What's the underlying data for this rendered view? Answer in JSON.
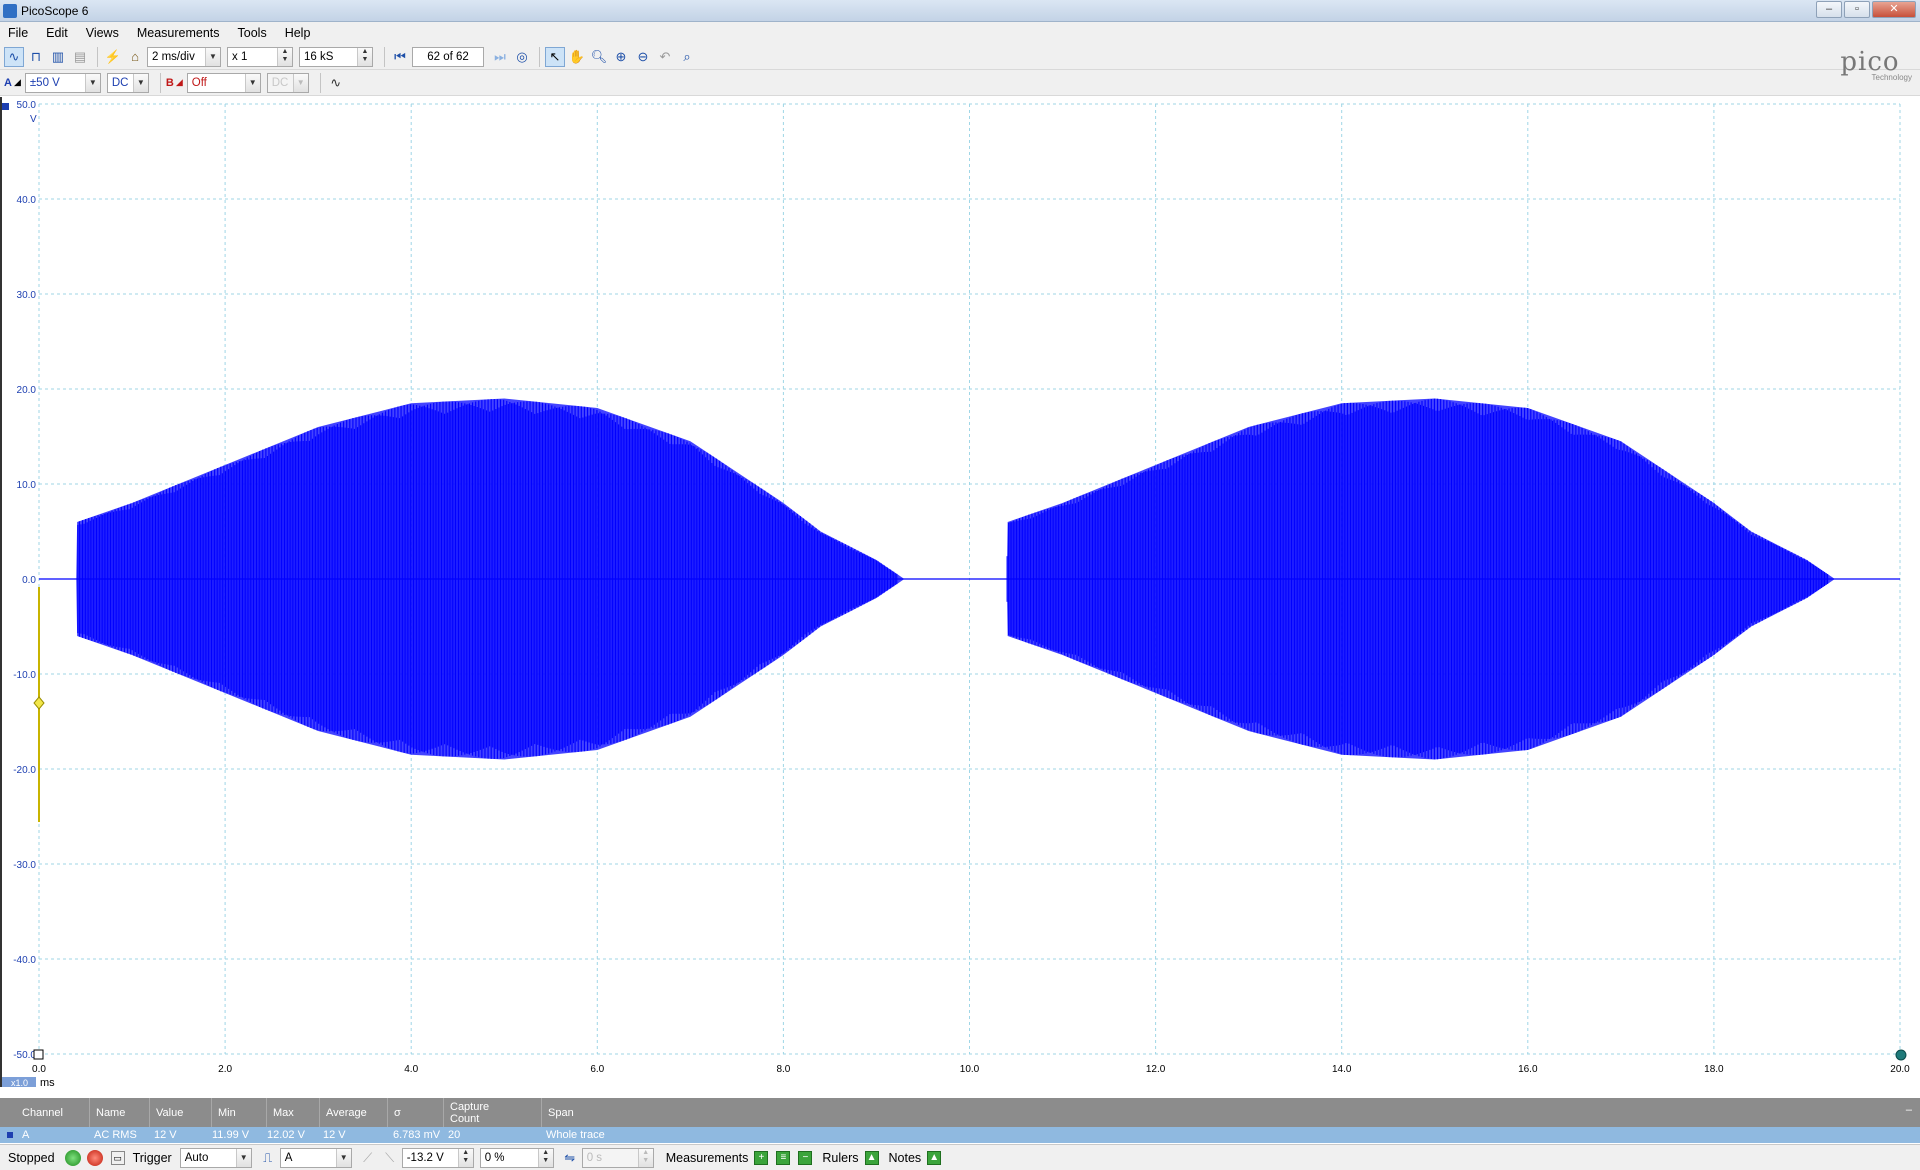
{
  "window": {
    "title": "PicoScope 6"
  },
  "menu": [
    "File",
    "Edit",
    "Views",
    "Measurements",
    "Tools",
    "Help"
  ],
  "toolbar": {
    "timebase": "2 ms/div",
    "zoom": "x 1",
    "samples": "16 kS",
    "buffer": "62 of 62"
  },
  "channel_a": {
    "label": "A",
    "range": "±50 V",
    "coupling": "DC"
  },
  "channel_b": {
    "label": "B",
    "range": "Off",
    "coupling": "DC"
  },
  "logo": {
    "word": "pico",
    "sub": "Technology"
  },
  "plot": {
    "y_unit": "V",
    "x_unit": "ms",
    "x_scale": "x1.0",
    "y_ticks": [
      "50.0",
      "40.0",
      "30.0",
      "20.0",
      "10.0",
      "0.0",
      "-10.0",
      "-20.0",
      "-30.0",
      "-40.0",
      "-50.0"
    ],
    "x_ticks": [
      "0.0",
      "2.0",
      "4.0",
      "6.0",
      "8.0",
      "10.0",
      "12.0",
      "14.0",
      "16.0",
      "18.0",
      "20.0"
    ]
  },
  "chart_data": {
    "type": "line",
    "xlabel": "ms",
    "ylabel": "V",
    "xlim": [
      0,
      20
    ],
    "ylim": [
      -50,
      50
    ],
    "grid": true,
    "series": [
      {
        "color": "#0000ff",
        "envelope_time_ms": [
          0.0,
          0.4,
          0.41,
          1.0,
          2.0,
          3.0,
          4.0,
          5.0,
          6.0,
          7.0,
          8.0,
          8.4,
          9.0,
          9.3,
          10.4,
          10.41,
          11.0,
          12.0,
          13.0,
          14.0,
          15.0,
          16.0,
          17.0,
          18.0,
          18.4,
          19.0,
          19.3,
          20.0
        ],
        "envelope_peak_v": [
          0.0,
          0.0,
          6.0,
          8.0,
          12.0,
          16.0,
          18.5,
          19.0,
          18.0,
          14.5,
          8.0,
          5.0,
          2.0,
          0.0,
          0.0,
          6.0,
          8.0,
          12.0,
          16.0,
          18.5,
          19.0,
          18.0,
          14.5,
          8.0,
          5.0,
          2.0,
          0.0,
          0.0
        ]
      }
    ]
  },
  "measurements": {
    "headers": [
      "Channel",
      "Name",
      "Value",
      "Min",
      "Max",
      "Average",
      "σ",
      "Capture Count",
      "Span"
    ],
    "row": [
      "A",
      "AC RMS",
      "12 V",
      "11.99 V",
      "12.02 V",
      "12 V",
      "6.783 mV",
      "20",
      "Whole trace"
    ]
  },
  "status": {
    "state": "Stopped",
    "trigger_label": "Trigger",
    "trigger_mode": "Auto",
    "trigger_source": "A",
    "trigger_level": "-13.2 V",
    "pre_trigger": "0 %",
    "delay": "0 s",
    "measurements_label": "Measurements",
    "rulers_label": "Rulers",
    "notes_label": "Notes"
  }
}
